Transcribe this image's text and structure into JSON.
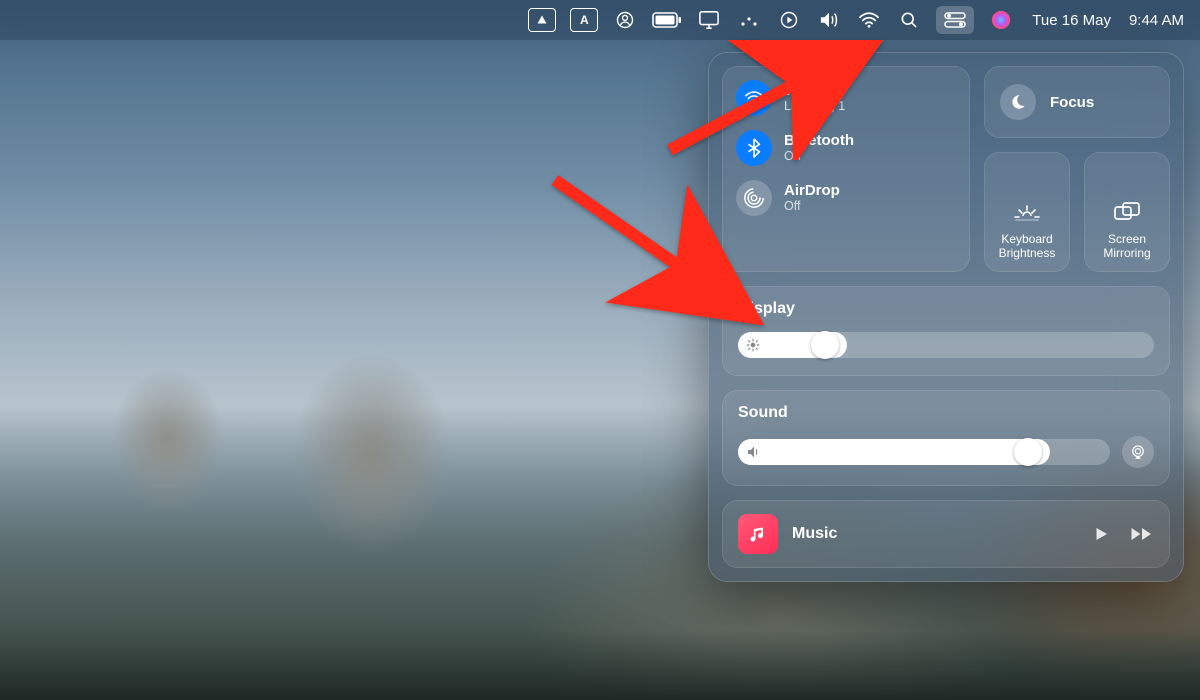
{
  "menubar": {
    "date_text": "Tue 16 May",
    "time_text": "9:44 AM"
  },
  "cc": {
    "wifi": {
      "title": "Wi-Fi",
      "subtitle": "Lightning 1"
    },
    "bluetooth": {
      "title": "Bluetooth",
      "subtitle": "On"
    },
    "airdrop": {
      "title": "AirDrop",
      "subtitle": "Off"
    },
    "focus": {
      "title": "Focus"
    },
    "keyboard_brightness": {
      "label": "Keyboard Brightness"
    },
    "screen_mirroring": {
      "label": "Screen Mirroring"
    },
    "display": {
      "title": "Display",
      "value_pct": 21
    },
    "sound": {
      "title": "Sound",
      "value_pct": 78
    },
    "now_playing": {
      "title": "Music"
    }
  }
}
